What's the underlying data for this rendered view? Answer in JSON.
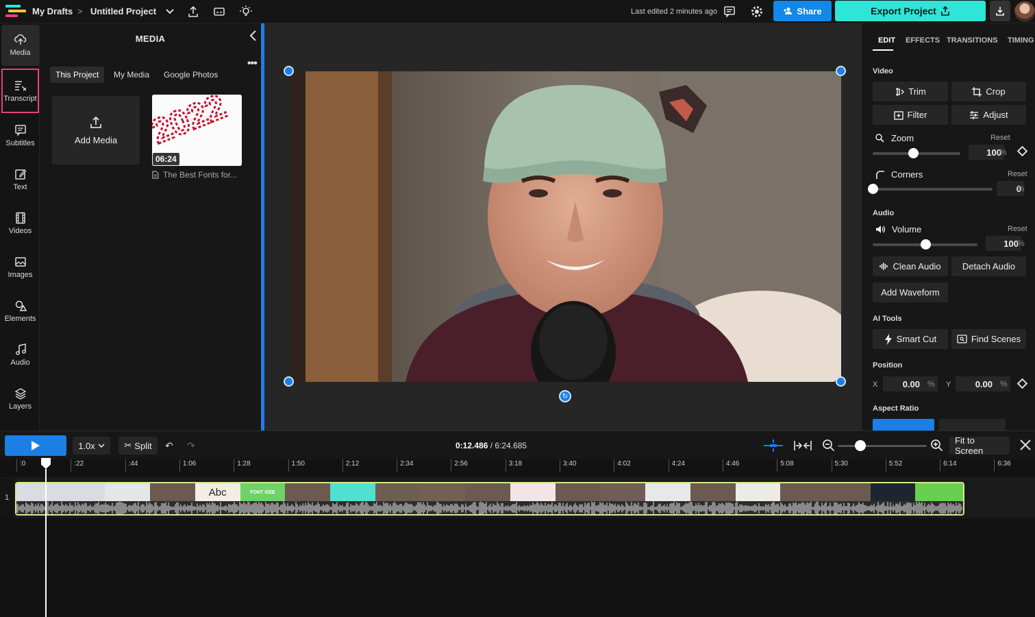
{
  "topbar": {
    "breadcrumb_root": "My Drafts",
    "breadcrumb_sep": ">",
    "project_name": "Untitled Project",
    "last_edited": "Last edited 2 minutes ago",
    "share_label": "Share",
    "export_label": "Export Project"
  },
  "rail": {
    "items": [
      {
        "label": "Media",
        "icon": "upload-cloud-icon"
      },
      {
        "label": "Transcript",
        "icon": "transcript-icon"
      },
      {
        "label": "Subtitles",
        "icon": "subtitles-icon"
      },
      {
        "label": "Text",
        "icon": "text-edit-icon"
      },
      {
        "label": "Videos",
        "icon": "film-icon"
      },
      {
        "label": "Images",
        "icon": "image-icon"
      },
      {
        "label": "Elements",
        "icon": "shapes-icon"
      },
      {
        "label": "Audio",
        "icon": "music-note-icon"
      },
      {
        "label": "Layers",
        "icon": "layers-icon"
      }
    ]
  },
  "media_panel": {
    "title": "MEDIA",
    "tabs": [
      "This Project",
      "My Media",
      "Google Photos"
    ],
    "add_media_label": "Add Media",
    "thumb_duration": "06:24",
    "thumb_name": "The Best Fonts for...",
    "thumb_art_text": "2022"
  },
  "right_panel": {
    "tabs": [
      "EDIT",
      "EFFECTS",
      "TRANSITIONS",
      "TIMING"
    ],
    "video_section": "Video",
    "trim": "Trim",
    "crop": "Crop",
    "filter": "Filter",
    "adjust": "Adjust",
    "zoom_label": "Zoom",
    "zoom_value": "100",
    "corners_label": "Corners",
    "corners_value": "0",
    "reset_label": "Reset",
    "percent": "%",
    "audio_section": "Audio",
    "volume_label": "Volume",
    "volume_value": "100",
    "clean_audio": "Clean Audio",
    "detach_audio": "Detach Audio",
    "add_waveform": "Add Waveform",
    "ai_tools_section": "AI Tools",
    "smart_cut": "Smart Cut",
    "find_scenes": "Find Scenes",
    "position_section": "Position",
    "x_label": "X",
    "x_value": "0.00",
    "y_label": "Y",
    "y_value": "0.00",
    "aspect_ratio_section": "Aspect Ratio",
    "zoom_level": 0.46,
    "corners_level": 0.0,
    "volume_level": 0.5
  },
  "timeline": {
    "speed": "1.0x",
    "split_label": "Split",
    "current_time": "0:12.486",
    "total_time": "/ 6:24.685",
    "fit_label": "Fit to Screen",
    "track_number": "1",
    "ruler_ticks": [
      ":0",
      ":22",
      ":44",
      "1:06",
      "1:28",
      "1:50",
      "2:12",
      "2:34",
      "2:56",
      "3:18",
      "3:40",
      "4:02",
      "4:24",
      "4:46",
      "5:08",
      "5:30",
      "5:52",
      "6:14",
      "6:36"
    ],
    "clip_texts": {
      "abc": "Abc",
      "font_size": "FONT SIZE"
    },
    "zoom_slider_level": 0.25
  },
  "colors": {
    "accent_blue": "#1c7fe6",
    "export_teal": "#2ee5d6",
    "highlight_pink": "#e5417b",
    "clip_border": "#d4ea8a"
  }
}
